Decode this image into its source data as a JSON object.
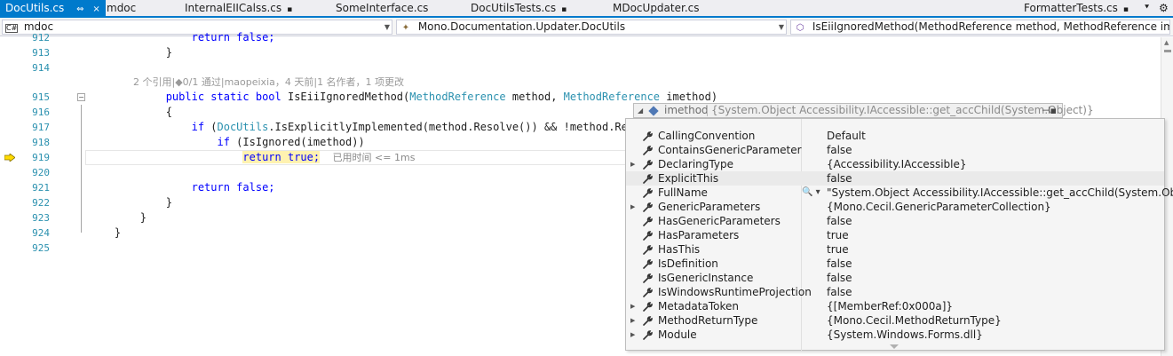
{
  "tabs": [
    {
      "label": "DocUtils.cs",
      "active": true,
      "pin": "⇔",
      "close": "×"
    },
    {
      "label": "mdoc"
    },
    {
      "label": "InternalEIICalss.cs",
      "glyph": "▪"
    },
    {
      "label": "SomeInterface.cs"
    },
    {
      "label": "DocUtilsTests.cs",
      "glyph": "▪"
    },
    {
      "label": "MDocUpdater.cs"
    },
    {
      "label": "FormatterTests.cs",
      "glyph": "▪"
    }
  ],
  "tab_overflow_icon": "⯆",
  "nav": {
    "project": "mdoc",
    "type": "Mono.Documentation.Updater.DocUtils",
    "member": "IsEiiIgnoredMethod(MethodReference method, MethodReference imethod)"
  },
  "lines": [
    {
      "num": "912",
      "code": [
        {
          "t": "                ",
          "c": ""
        },
        {
          "t": "return false;",
          "c": "kw"
        }
      ]
    },
    {
      "num": "913",
      "code": [
        {
          "t": "            }",
          "c": ""
        }
      ]
    },
    {
      "num": "914",
      "code": [
        {
          "t": "",
          "c": ""
        }
      ]
    },
    {
      "num": "915",
      "code": [
        {
          "t": "            ",
          "c": ""
        },
        {
          "t": "public static bool",
          "c": "kw"
        },
        {
          "t": " IsEiiIgnoredMethod(",
          "c": ""
        },
        {
          "t": "MethodReference",
          "c": "ty"
        },
        {
          "t": " method, ",
          "c": ""
        },
        {
          "t": "MethodReference",
          "c": "ty"
        },
        {
          "t": " imethod)",
          "c": ""
        }
      ]
    },
    {
      "num": "916",
      "code": [
        {
          "t": "            {",
          "c": ""
        }
      ]
    },
    {
      "num": "917",
      "code": [
        {
          "t": "                ",
          "c": ""
        },
        {
          "t": "if",
          "c": "kw"
        },
        {
          "t": " (",
          "c": ""
        },
        {
          "t": "DocUtils",
          "c": "ty"
        },
        {
          "t": ".IsExplicitlyImplemented(method.Resolve()) && !method.Resolve().",
          "c": ""
        }
      ]
    },
    {
      "num": "918",
      "code": [
        {
          "t": "                    ",
          "c": ""
        },
        {
          "t": "if",
          "c": "kw"
        },
        {
          "t": " (IsIgnored(imethod))",
          "c": ""
        }
      ]
    },
    {
      "num": "919",
      "code": []
    },
    {
      "num": "920",
      "code": [
        {
          "t": "",
          "c": ""
        }
      ]
    },
    {
      "num": "921",
      "code": [
        {
          "t": "                ",
          "c": ""
        },
        {
          "t": "return false;",
          "c": "kw"
        }
      ]
    },
    {
      "num": "922",
      "code": [
        {
          "t": "            }",
          "c": ""
        }
      ]
    },
    {
      "num": "923",
      "code": [
        {
          "t": "        }",
          "c": ""
        }
      ]
    },
    {
      "num": "924",
      "code": [
        {
          "t": "    }",
          "c": ""
        }
      ]
    },
    {
      "num": "925",
      "code": [
        {
          "t": "",
          "c": ""
        }
      ]
    }
  ],
  "codelens": "2 个引用|◆0/1 通过|maopeixia，4 天前|1 名作者，1 项更改",
  "current_statement": {
    "indent": "                        ",
    "return_kw": "return",
    "true_kw": " true;",
    "elapsed": "已用时间 <= 1ms"
  },
  "datatip": {
    "name": "imethod",
    "value": "{System.Object Accessibility.IAccessible::get_accChild(System.Object)}",
    "rows": [
      {
        "name": "CallingConvention",
        "value": "Default",
        "expandable": false
      },
      {
        "name": "ContainsGenericParameter",
        "value": "false",
        "expandable": false
      },
      {
        "name": "DeclaringType",
        "value": "{Accessibility.IAccessible}",
        "expandable": true
      },
      {
        "name": "ExplicitThis",
        "value": "false",
        "expandable": false,
        "hover": true
      },
      {
        "name": "FullName",
        "value": "\"System.Object Accessibility.IAccessible::get_accChild(System.Object)\"",
        "expandable": false,
        "magnifier": "🔍 ▾"
      },
      {
        "name": "GenericParameters",
        "value": "{Mono.Cecil.GenericParameterCollection}",
        "expandable": true
      },
      {
        "name": "HasGenericParameters",
        "value": "false",
        "expandable": false
      },
      {
        "name": "HasParameters",
        "value": "true",
        "expandable": false
      },
      {
        "name": "HasThis",
        "value": "true",
        "expandable": false
      },
      {
        "name": "IsDefinition",
        "value": "false",
        "expandable": false
      },
      {
        "name": "IsGenericInstance",
        "value": "false",
        "expandable": false
      },
      {
        "name": "IsWindowsRuntimeProjection",
        "value": "false",
        "expandable": false
      },
      {
        "name": "MetadataToken",
        "value": "{[MemberRef:0x000a]}",
        "expandable": true
      },
      {
        "name": "MethodReturnType",
        "value": "{Mono.Cecil.MethodReturnType}",
        "expandable": true
      },
      {
        "name": "Module",
        "value": "{System.Windows.Forms.dll}",
        "expandable": true
      }
    ]
  },
  "colors": {
    "accent": "#007acc",
    "keyword": "#0000ff",
    "type": "#2b91af",
    "current_stmt": "#fff2b0"
  }
}
